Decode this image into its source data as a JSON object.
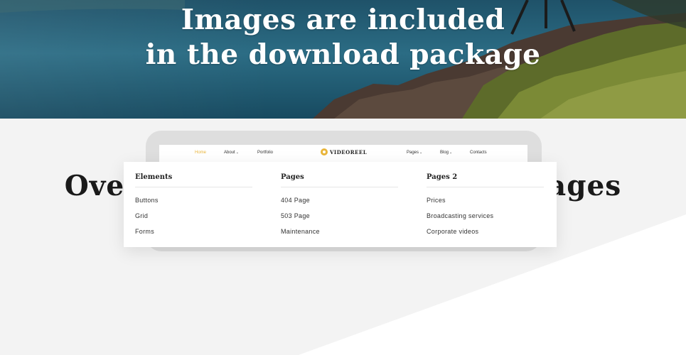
{
  "hero": {
    "title_line1": "Images are included",
    "title_line2": "in the download package"
  },
  "section": {
    "title": "Over 30 ready made HTML5 pages"
  },
  "mockup": {
    "nav": {
      "home": "Home",
      "about": "About",
      "portfolio": "Portfolio",
      "logo": "VIDEOREEL",
      "pages": "Pages",
      "blog": "Blog",
      "contacts": "Contacts",
      "chevron": "⌄"
    },
    "columns": [
      {
        "heading": "Elements",
        "items": [
          "Buttons",
          "Grid",
          "Forms"
        ]
      },
      {
        "heading": "Pages",
        "items": [
          "404 Page",
          "503 Page",
          "Maintenance"
        ]
      },
      {
        "heading": "Pages 2",
        "items": [
          "Prices",
          "Broadcasting services",
          "Corporate videos"
        ]
      }
    ]
  },
  "colors": {
    "accent": "#e9b53a",
    "hero_water": "#2b6c84",
    "background": "#f3f3f3",
    "heading": "#1a1a1a"
  }
}
